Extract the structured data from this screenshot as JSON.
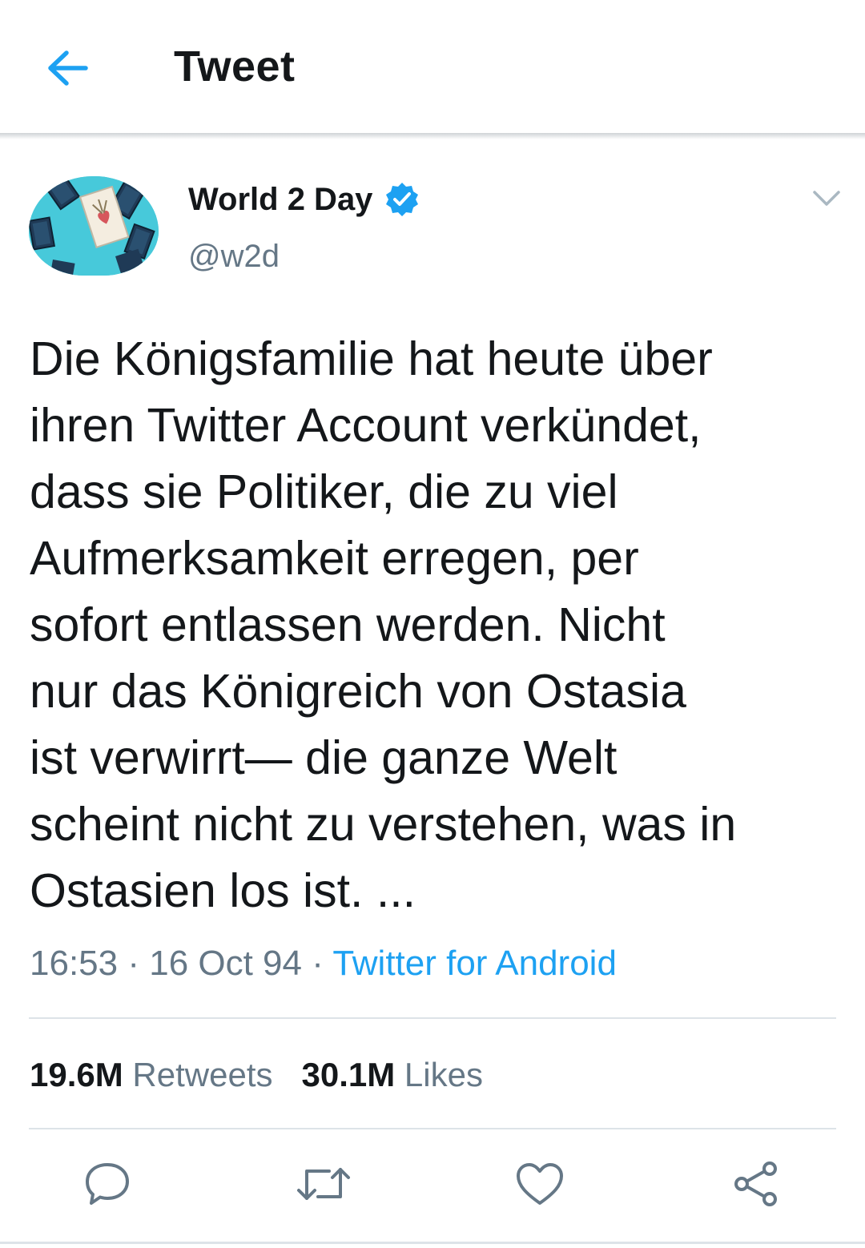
{
  "header": {
    "title": "Tweet"
  },
  "author": {
    "display_name": "World 2 Day",
    "handle": "@w2d",
    "verified": true
  },
  "tweet": {
    "text": "Die Königsfamilie hat heute über\nihren Twitter Account verkündet,\ndass sie Politiker, die zu viel\nAufmerksamkeit erregen, per\nsofort entlassen werden. Nicht\nnur das Königreich von Ostasia\nist verwirrt— die ganze Welt\nscheint nicht zu verstehen, was in\nOstasien los ist. ...",
    "time": "16:53",
    "separator": " · ",
    "date": "16 Oct 94",
    "source": "Twitter for Android"
  },
  "stats": {
    "retweets_count": "19.6M",
    "retweets_label": "Retweets",
    "likes_count": "30.1M",
    "likes_label": "Likes"
  },
  "colors": {
    "accent": "#1da1f2",
    "secondary_text": "#657786",
    "primary_text": "#14171a",
    "divider": "#dde3e8"
  },
  "icons": {
    "back": "arrow-left-icon",
    "verified": "verified-badge-icon",
    "menu": "chevron-down-icon",
    "reply": "reply-icon",
    "retweet": "retweet-icon",
    "like": "heart-icon",
    "share": "share-icon"
  }
}
